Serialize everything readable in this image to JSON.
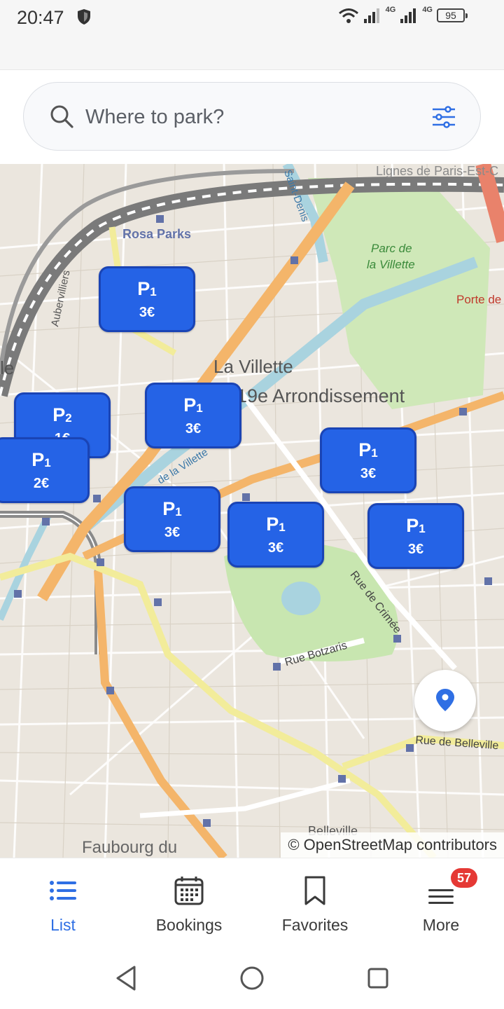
{
  "status_bar": {
    "time": "20:47",
    "net1": "4G",
    "net2": "4G",
    "battery": "95",
    "icons": [
      "shield-icon",
      "wifi-icon",
      "signal-icon",
      "battery-icon"
    ]
  },
  "search": {
    "placeholder": "Where to park?",
    "value": "",
    "icons": [
      "search-icon",
      "filter-icon"
    ]
  },
  "map": {
    "labels": {
      "rosa_parks": "Rosa Parks",
      "lignes": "Lignes de Paris-Est-C",
      "parc_villette_1": "Parc de",
      "parc_villette_2": "la Villette",
      "porte": "Porte de",
      "la_villette": "La Villette",
      "arrondissement": "19e Arrondissement",
      "aubervilliers": "Aubervilliers",
      "canal_saint_denis": "Saint-Denis",
      "canal_ourcq": "de la Villette",
      "rue_crimee": "Rue de Crimée",
      "rue_botzaris": "Rue Botzaris",
      "rue_belleville": "Rue de Belleville",
      "belleville": "Belleville",
      "faubourg": "Faubourg du",
      "le": "le"
    },
    "markers": [
      {
        "label": "P",
        "count": "1",
        "price": "3€"
      },
      {
        "label": "P",
        "count": "2",
        "price": "1€"
      },
      {
        "label": "P",
        "count": "1",
        "price": "3€"
      },
      {
        "label": "P",
        "count": "1",
        "price": "2€"
      },
      {
        "label": "P",
        "count": "1",
        "price": "3€"
      },
      {
        "label": "P",
        "count": "1",
        "price": "3€"
      },
      {
        "label": "P",
        "count": "1",
        "price": "3€"
      },
      {
        "label": "P",
        "count": "1",
        "price": "3€"
      }
    ],
    "attribution": "© OpenStreetMap contributors",
    "colors": {
      "marker": "#2563e6",
      "primary_road": "#f4b56a",
      "secondary_road": "#f2ec9a",
      "park": "#c8e6b0",
      "water": "#a9d3df"
    }
  },
  "bottom_nav": {
    "items": [
      {
        "label": "List",
        "icon": "list-icon",
        "active": true
      },
      {
        "label": "Bookings",
        "icon": "calendar-icon",
        "active": false
      },
      {
        "label": "Favorites",
        "icon": "bookmark-icon",
        "active": false
      },
      {
        "label": "More",
        "icon": "menu-icon",
        "active": false
      }
    ],
    "more_badge": "57",
    "accent": "#2f6fe4"
  },
  "android_nav": {
    "icons": [
      "back-icon",
      "home-icon",
      "recents-icon"
    ]
  }
}
